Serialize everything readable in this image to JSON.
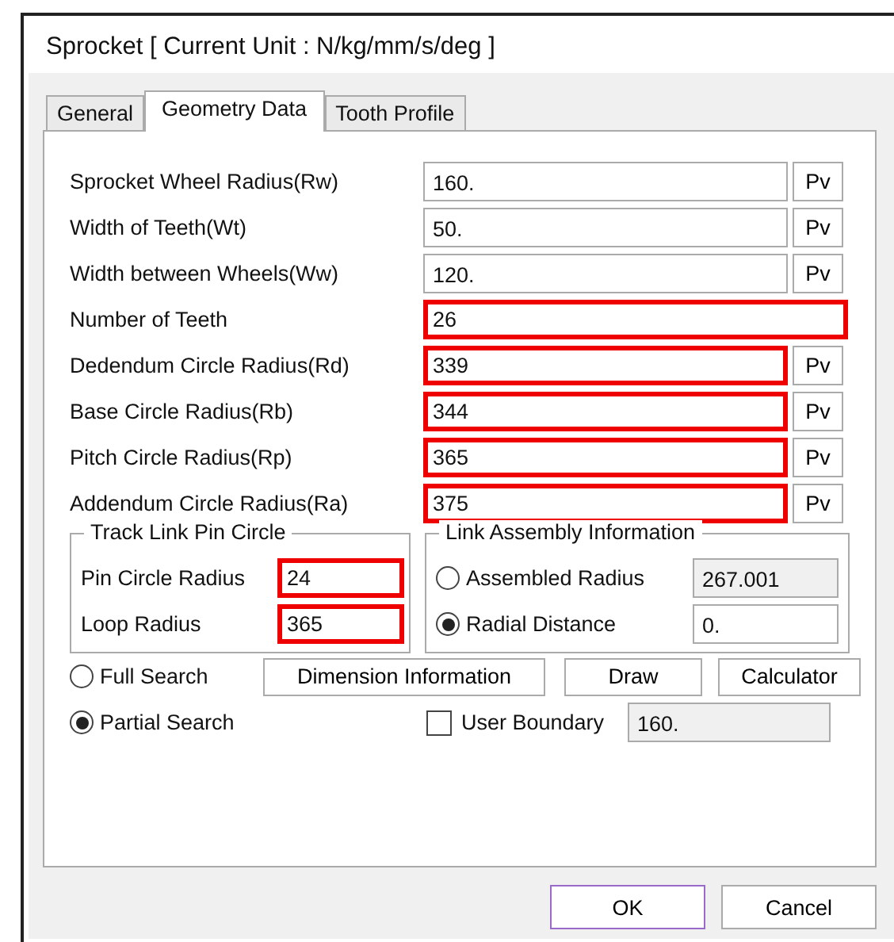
{
  "window": {
    "title": "Sprocket [ Current Unit : N/kg/mm/s/deg ]"
  },
  "tabs": [
    {
      "label": "General",
      "selected": false
    },
    {
      "label": "Geometry Data",
      "selected": true
    },
    {
      "label": "Tooth Profile",
      "selected": false
    }
  ],
  "fields": [
    {
      "label": "Sprocket Wheel Radius(Rw)",
      "value": "160.",
      "pv": "Pv",
      "highlighted": false
    },
    {
      "label": "Width of Teeth(Wt)",
      "value": "50.",
      "pv": "Pv",
      "highlighted": false
    },
    {
      "label": "Width between Wheels(Ww)",
      "value": "120.",
      "pv": "Pv",
      "highlighted": false
    },
    {
      "label": "Number of Teeth",
      "value": "26",
      "highlighted": true
    },
    {
      "label": "Dedendum Circle Radius(Rd)",
      "value": "339",
      "pv": "Pv",
      "highlighted": true
    },
    {
      "label": "Base Circle Radius(Rb)",
      "value": "344",
      "pv": "Pv",
      "highlighted": true
    },
    {
      "label": "Pitch Circle Radius(Rp)",
      "value": "365",
      "pv": "Pv",
      "highlighted": true
    },
    {
      "label": "Addendum Circle Radius(Ra)",
      "value": "375",
      "pv": "Pv",
      "highlighted": true
    }
  ],
  "track_link_pin_circle": {
    "title": "Track Link Pin Circle",
    "fields": [
      {
        "label": "Pin Circle Radius",
        "value": "24",
        "highlighted": true
      },
      {
        "label": "Loop Radius",
        "value": "365",
        "highlighted": true
      }
    ]
  },
  "link_assembly_information": {
    "title": "Link Assembly Information",
    "options": [
      {
        "label": "Assembled Radius",
        "value": "267.001",
        "selected": false
      },
      {
        "label": "Radial Distance",
        "value": "0.",
        "selected": true
      }
    ]
  },
  "search_options": [
    {
      "label": "Full Search",
      "selected": false
    },
    {
      "label": "Partial Search",
      "selected": true
    }
  ],
  "action_buttons": [
    "Dimension Information",
    "Draw",
    "Calculator"
  ],
  "user_boundary": {
    "label": "User Boundary",
    "checked": false,
    "value": "160."
  },
  "dialog_buttons": [
    {
      "label": "OK",
      "default": true
    },
    {
      "label": "Cancel",
      "default": false
    }
  ]
}
